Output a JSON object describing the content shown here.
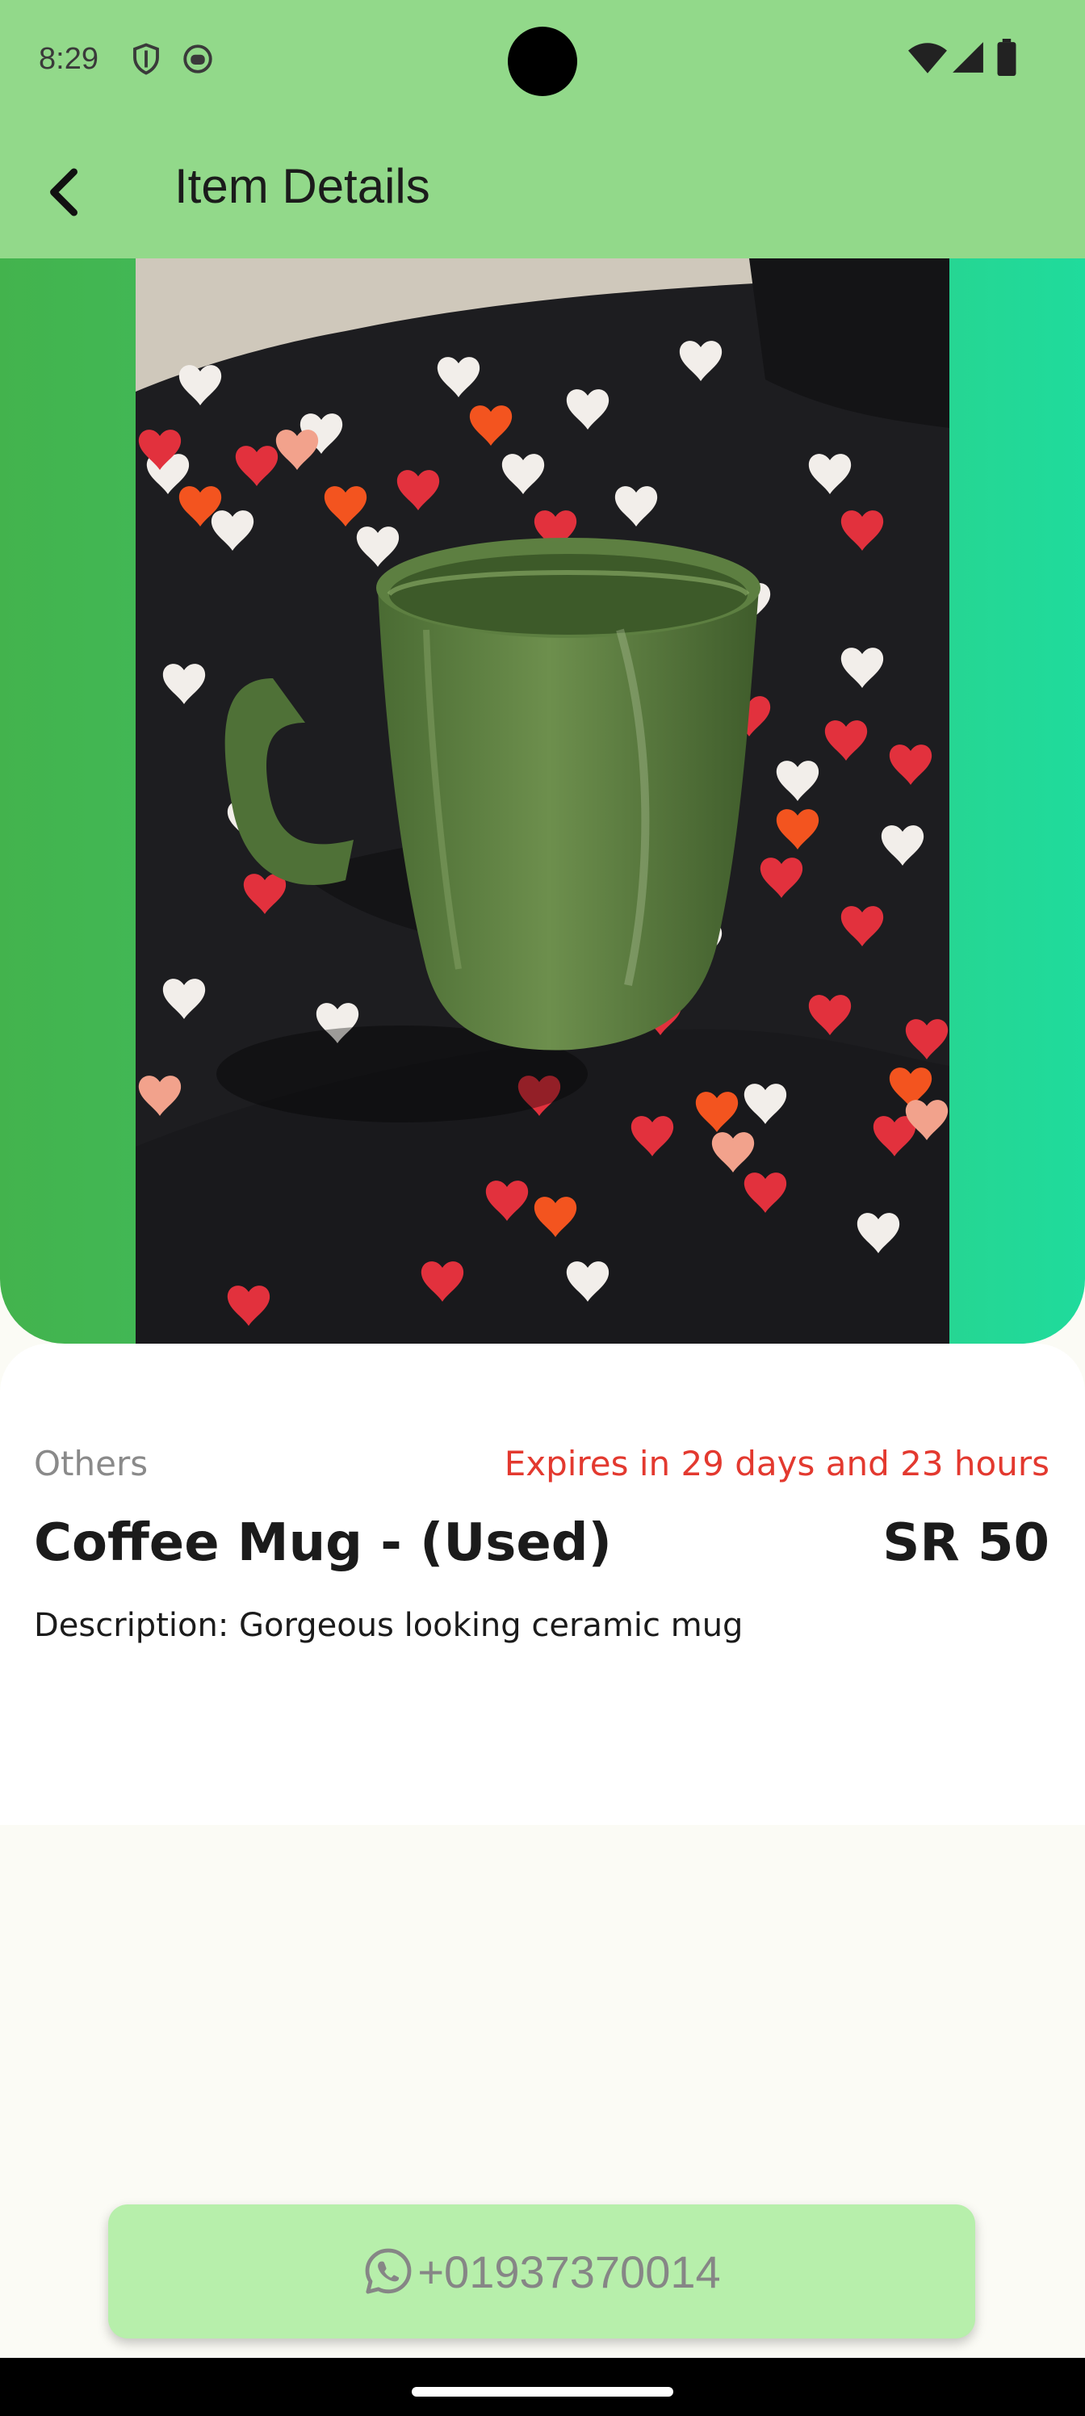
{
  "status_bar": {
    "time": "8:29",
    "left_icons": [
      "shield-icon",
      "face-mask-icon"
    ],
    "right_icons": [
      "wifi-icon",
      "cell-signal-icon",
      "battery-icon"
    ],
    "background": "#92d98a"
  },
  "app_bar": {
    "title": "Item Details",
    "back_icon": "chevron-left-icon"
  },
  "hero": {
    "photo_subject": "green ceramic mug on black heart-print fabric",
    "gradient_colors": [
      "#43b34d",
      "#1fdb9c"
    ]
  },
  "item": {
    "category": "Others",
    "expiry": "Expires in 29 days and 23 hours",
    "name": "Coffee Mug - (Used)",
    "price": "SR 50",
    "description": "Description: Gorgeous looking ceramic mug"
  },
  "contact": {
    "icon": "whatsapp-icon",
    "phone": "+01937370014",
    "button_color": "#b7efab"
  },
  "colors": {
    "accent": "#92d98a",
    "expiry_text": "#e3392f"
  }
}
